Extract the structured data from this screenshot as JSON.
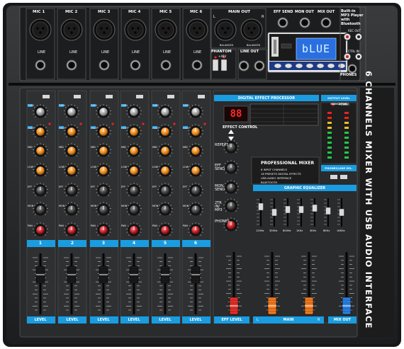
{
  "mixer": {
    "side_title": "6 CHANNELS MIXER WITH USB AUDIO INTERFACE",
    "mic_labels": [
      "MIC 1",
      "MIC 2",
      "MIC 3",
      "MIC 4",
      "MIC 5",
      "MIC 6"
    ],
    "line_label": "LINE",
    "channel_numbers": [
      "1",
      "2",
      "3",
      "4",
      "5",
      "6"
    ],
    "level_label": "LEVEL",
    "main_out_label": "MAIN OUT",
    "main_out_l": "L",
    "main_out_r": "R",
    "balanced_label": "BALANCED",
    "phantom_label": "PHANTOM",
    "phantom_sub": "+48V",
    "line_out_label": "LINE OUT",
    "eff_send_label": "EFF SEND",
    "mon_out_label": "MON OUT",
    "mix_out_label": "MIX OUT",
    "mp3_box_label": "Built-in MP3 Player with Bluetooth",
    "rec_out_label": "REC OUT",
    "ctrl_in_label": "CTRL IN",
    "phones_label": "PHONES",
    "lcd_text": "bLUE",
    "dsp_title": "DIGITAL EFFECT PROCESSOR",
    "dsp_display": "88",
    "effect_control_label": "EFFECT CONTROL",
    "effect_knobs": [
      "REPEAT",
      "EFF SEND",
      "MON SEND",
      "2TR IN/ MP3",
      "PHONES"
    ],
    "pro_mixer_title": "PROFESSIONAL MIXER",
    "pro_mixer_features": [
      "6 INPUT CHANNELS",
      "16 PRESETS DIGITAL EFFECTS",
      "USB AUDIO INTERFACE",
      "BLUETOOTH"
    ],
    "output_indicator_title": "OUTPUT LEVEL INDICATOR",
    "power_label": "POWER",
    "phones_mon_label": "PHONES/LINE SEL.",
    "graphic_eq_title": "GRAPHIC EQUALIZER",
    "eq_bands": [
      "120Hz",
      "300Hz",
      "800Hz",
      "1KHz",
      "3KHz",
      "8KHz",
      "16KHz"
    ],
    "channel_knob_labels": [
      "GAIN",
      "HIGH",
      "MID",
      "LOW",
      "EFF",
      "MON",
      "PAN"
    ],
    "clip_label": "CLIP",
    "eff_level_label": "EFF LEVEL",
    "main_label": "MAIN",
    "mix_out_fader_label": "MIX OUT",
    "main_fader_l": "L",
    "main_fader_r": "R",
    "colors": {
      "body": "#242526",
      "panel": "#2e2f31",
      "accent_blue": "#1a9ce0",
      "orange_knob": "#f08a1c",
      "red_knob": "#c8202a",
      "red_fader": "#e0302a",
      "orange_fader": "#f07a20",
      "blue_fader": "#2a7fe0",
      "lcd_blue": "#2a6fe0"
    }
  }
}
